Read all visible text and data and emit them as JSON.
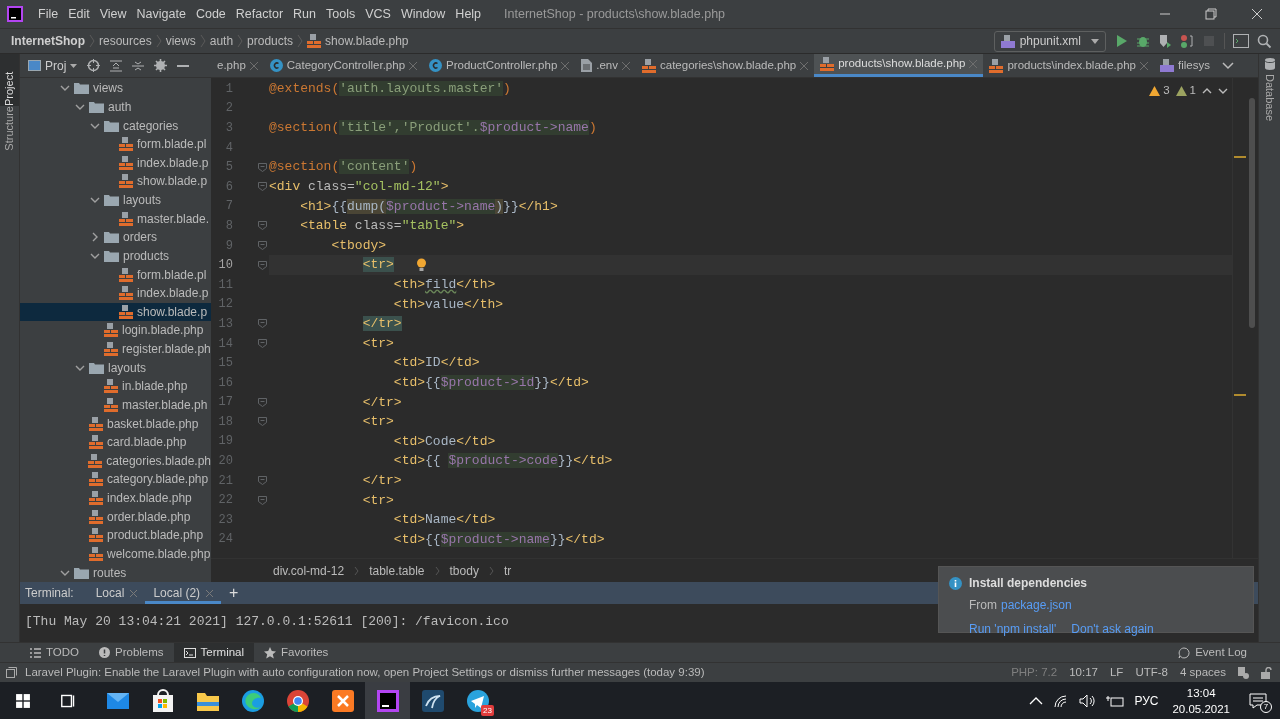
{
  "window": {
    "title": "InternetShop - products\\show.blade.php"
  },
  "menu": [
    "File",
    "Edit",
    "View",
    "Navigate",
    "Code",
    "Refactor",
    "Run",
    "Tools",
    "VCS",
    "Window",
    "Help"
  ],
  "navbar": {
    "crumbs": [
      "InternetShop",
      "resources",
      "views",
      "auth",
      "products",
      "show.blade.php"
    ],
    "run_config": "phpunit.xml"
  },
  "side_tabs": [
    {
      "label": "Project",
      "selected": true
    },
    {
      "label": "Structure",
      "selected": false
    }
  ],
  "right_tabs": [
    {
      "label": "Database",
      "selected": false
    }
  ],
  "project_panel": {
    "title": "Proj"
  },
  "editor_tabs": [
    {
      "label": "e.php",
      "selected": false
    },
    {
      "label": "CategoryController.php",
      "kind": "class",
      "selected": false
    },
    {
      "label": "ProductController.php",
      "kind": "class",
      "selected": false
    },
    {
      "label": ".env",
      "kind": "text",
      "selected": false
    },
    {
      "label": "categories\\show.blade.php",
      "kind": "blade",
      "selected": false
    },
    {
      "label": "products\\show.blade.php",
      "kind": "blade",
      "selected": true
    },
    {
      "label": "products\\index.blade.php",
      "kind": "blade",
      "selected": false
    },
    {
      "label": "filesys",
      "kind": "php",
      "selected": false
    }
  ],
  "tree": [
    {
      "name": "views",
      "kind": "folder",
      "expanded": true,
      "selected": false,
      "children": [
        {
          "name": "auth",
          "kind": "folder",
          "expanded": true,
          "selected": false,
          "children": [
            {
              "name": "categories",
              "kind": "folder",
              "expanded": true,
              "selected": false,
              "children": [
                {
                  "name": "form.blade.pl",
                  "kind": "file",
                  "selected": false
                },
                {
                  "name": "index.blade.p",
                  "kind": "file",
                  "selected": false
                },
                {
                  "name": "show.blade.p",
                  "kind": "file",
                  "selected": false
                }
              ]
            },
            {
              "name": "layouts",
              "kind": "folder",
              "expanded": true,
              "selected": false,
              "children": [
                {
                  "name": "master.blade.",
                  "kind": "file",
                  "selected": false
                }
              ]
            },
            {
              "name": "orders",
              "kind": "folder",
              "expanded": false,
              "selected": false
            },
            {
              "name": "products",
              "kind": "folder",
              "expanded": true,
              "selected": false,
              "children": [
                {
                  "name": "form.blade.pl",
                  "kind": "file",
                  "selected": false
                },
                {
                  "name": "index.blade.p",
                  "kind": "file",
                  "selected": false
                },
                {
                  "name": "show.blade.p",
                  "kind": "file",
                  "selected": true
                }
              ]
            },
            {
              "name": "login.blade.php",
              "kind": "file",
              "selected": false
            },
            {
              "name": "register.blade.ph",
              "kind": "file",
              "selected": false
            }
          ]
        },
        {
          "name": "layouts",
          "kind": "folder",
          "expanded": true,
          "selected": false,
          "children": [
            {
              "name": "in.blade.php",
              "kind": "file",
              "selected": false
            },
            {
              "name": "master.blade.ph",
              "kind": "file",
              "selected": false
            }
          ]
        },
        {
          "name": "basket.blade.php",
          "kind": "file",
          "selected": false
        },
        {
          "name": "card.blade.php",
          "kind": "file",
          "selected": false
        },
        {
          "name": "categories.blade.ph",
          "kind": "file",
          "selected": false
        },
        {
          "name": "category.blade.php",
          "kind": "file",
          "selected": false
        },
        {
          "name": "index.blade.php",
          "kind": "file",
          "selected": false
        },
        {
          "name": "order.blade.php",
          "kind": "file",
          "selected": false
        },
        {
          "name": "product.blade.php",
          "kind": "file",
          "selected": false
        },
        {
          "name": "welcome.blade.php",
          "kind": "file",
          "selected": false
        }
      ]
    },
    {
      "name": "routes",
      "kind": "folder",
      "expanded": true,
      "selected": false
    }
  ],
  "inspections": {
    "warnings": "3",
    "weak_warnings": "1"
  },
  "code": [
    {
      "number": "1",
      "current": false,
      "fold": false,
      "tokens": [
        {
          "kind": "directive",
          "text": "@extends("
        },
        {
          "kind": "string",
          "text": "'auth.layouts.master'"
        },
        {
          "kind": "directive",
          "text": ")"
        }
      ]
    },
    {
      "number": "2",
      "current": false,
      "fold": false
    },
    {
      "number": "3",
      "current": false,
      "fold": false,
      "tokens": [
        {
          "kind": "directive",
          "text": "@section("
        },
        {
          "kind": "string",
          "text": "'title','Product'."
        },
        {
          "kind": "variable",
          "text": "$product->name"
        },
        {
          "kind": "directive",
          "text": ")"
        }
      ]
    },
    {
      "number": "4",
      "current": false,
      "fold": false
    },
    {
      "number": "5",
      "current": false,
      "fold": true,
      "tokens": [
        {
          "kind": "directive",
          "text": "@section("
        },
        {
          "kind": "string",
          "text": "'content'"
        },
        {
          "kind": "directive",
          "text": ")"
        }
      ]
    },
    {
      "number": "6",
      "current": false,
      "fold": true,
      "tokens": [
        {
          "kind": "tag",
          "text": "<div "
        },
        {
          "kind": "attr",
          "text": "class="
        },
        {
          "kind": "value",
          "text": "\"col-md-12\""
        },
        {
          "kind": "tag",
          "text": ">"
        }
      ]
    },
    {
      "number": "7",
      "current": false,
      "fold": false,
      "tokens": [
        {
          "kind": "tag",
          "text": "    <h1>"
        },
        {
          "kind": "text",
          "text": "{{"
        },
        {
          "kind": "call",
          "text": "dump("
        },
        {
          "kind": "variable",
          "text": "$product->name"
        },
        {
          "kind": "call",
          "text": ")"
        },
        {
          "kind": "text",
          "text": "}}"
        },
        {
          "kind": "tag",
          "text": "</h1>"
        }
      ]
    },
    {
      "number": "8",
      "current": false,
      "fold": true,
      "tokens": [
        {
          "kind": "tag",
          "text": "    <table "
        },
        {
          "kind": "attr",
          "text": "class="
        },
        {
          "kind": "value",
          "text": "\"table\""
        },
        {
          "kind": "tag",
          "text": ">"
        }
      ]
    },
    {
      "number": "9",
      "current": false,
      "fold": true,
      "tokens": [
        {
          "kind": "tag",
          "text": "        <tbody>"
        }
      ]
    },
    {
      "number": "10",
      "current": true,
      "fold": true,
      "tokens": [
        {
          "kind": "match",
          "text": "            <tr>"
        }
      ]
    },
    {
      "number": "11",
      "current": false,
      "fold": false,
      "tokens": [
        {
          "kind": "tag",
          "text": "                <th>"
        },
        {
          "kind": "typo",
          "text": "fild"
        },
        {
          "kind": "tag",
          "text": "</th>"
        }
      ]
    },
    {
      "number": "12",
      "current": false,
      "fold": false,
      "tokens": [
        {
          "kind": "tag",
          "text": "                <th>"
        },
        {
          "kind": "text",
          "text": "value"
        },
        {
          "kind": "tag",
          "text": "</th>"
        }
      ]
    },
    {
      "number": "13",
      "current": false,
      "fold": true,
      "tokens": [
        {
          "kind": "match",
          "text": "            </tr>"
        }
      ]
    },
    {
      "number": "14",
      "current": false,
      "fold": true,
      "tokens": [
        {
          "kind": "tag",
          "text": "            <tr>"
        }
      ]
    },
    {
      "number": "15",
      "current": false,
      "fold": false,
      "tokens": [
        {
          "kind": "tag",
          "text": "                <td>"
        },
        {
          "kind": "text",
          "text": "ID"
        },
        {
          "kind": "tag",
          "text": "</td>"
        }
      ]
    },
    {
      "number": "16",
      "current": false,
      "fold": false,
      "tokens": [
        {
          "kind": "tag",
          "text": "                <td>"
        },
        {
          "kind": "text",
          "text": "{{"
        },
        {
          "kind": "variable",
          "text": "$product->id"
        },
        {
          "kind": "text",
          "text": "}}"
        },
        {
          "kind": "tag",
          "text": "</td>"
        }
      ]
    },
    {
      "number": "17",
      "current": false,
      "fold": true,
      "tokens": [
        {
          "kind": "tag",
          "text": "            </tr>"
        }
      ]
    },
    {
      "number": "18",
      "current": false,
      "fold": true,
      "tokens": [
        {
          "kind": "tag",
          "text": "            <tr>"
        }
      ]
    },
    {
      "number": "19",
      "current": false,
      "fold": false,
      "tokens": [
        {
          "kind": "tag",
          "text": "                <td>"
        },
        {
          "kind": "text",
          "text": "Code"
        },
        {
          "kind": "tag",
          "text": "</td>"
        }
      ]
    },
    {
      "number": "20",
      "current": false,
      "fold": false,
      "tokens": [
        {
          "kind": "tag",
          "text": "                <td>"
        },
        {
          "kind": "text",
          "text": "{{"
        },
        {
          "kind": "variable",
          "text": " $product->code"
        },
        {
          "kind": "text",
          "text": "}}"
        },
        {
          "kind": "tag",
          "text": "</td>"
        }
      ]
    },
    {
      "number": "21",
      "current": false,
      "fold": true,
      "tokens": [
        {
          "kind": "tag",
          "text": "            </tr>"
        }
      ]
    },
    {
      "number": "22",
      "current": false,
      "fold": true,
      "tokens": [
        {
          "kind": "tag",
          "text": "            <tr>"
        }
      ]
    },
    {
      "number": "23",
      "current": false,
      "fold": false,
      "tokens": [
        {
          "kind": "tag",
          "text": "                <td>"
        },
        {
          "kind": "text",
          "text": "Name"
        },
        {
          "kind": "tag",
          "text": "</td>"
        }
      ]
    },
    {
      "number": "24",
      "current": false,
      "fold": false,
      "tokens": [
        {
          "kind": "tag",
          "text": "                <td>"
        },
        {
          "kind": "text",
          "text": "{{"
        },
        {
          "kind": "variable",
          "text": "$product->name"
        },
        {
          "kind": "text",
          "text": "}}"
        },
        {
          "kind": "tag",
          "text": "</td>"
        }
      ]
    }
  ],
  "editor_breadcrumbs": [
    "div.col-md-12",
    "table.table",
    "tbody",
    "tr"
  ],
  "terminal": {
    "label": "Terminal:",
    "tabs": [
      {
        "label": "Local",
        "selected": false
      },
      {
        "label": "Local (2)",
        "selected": true
      }
    ],
    "add": "+",
    "output": "[Thu May 20 13:04:21 2021] 127.0.0.1:52611 [200]: /favicon.ico"
  },
  "notification": {
    "title": "Install dependencies",
    "text": "From",
    "link": "package.json",
    "actions": [
      "Run 'npm install'",
      "Don't ask again"
    ]
  },
  "tool_windows": [
    {
      "label": "TODO",
      "kind": "list",
      "selected": false
    },
    {
      "label": "Problems",
      "kind": "problems",
      "selected": false
    },
    {
      "label": "Terminal",
      "kind": "terminal",
      "selected": true
    },
    {
      "label": "Favorites",
      "kind": "star",
      "selected": false
    }
  ],
  "event_log": "Event Log",
  "status_bar": {
    "message": "Laravel Plugin: Enable the Laravel Plugin with auto configuration now, open Project Settings or dismiss further messages (today 9:39)",
    "items": [
      "PHP: 7.2",
      "10:17",
      "LF",
      "UTF-8",
      "4 spaces"
    ]
  },
  "taskbar": {
    "apps": [
      {
        "kind": "start",
        "selected": false
      },
      {
        "kind": "taskview",
        "selected": false
      },
      {
        "kind": "mail",
        "selected": false
      },
      {
        "kind": "store",
        "selected": false
      },
      {
        "kind": "explorer",
        "selected": false
      },
      {
        "kind": "edge",
        "selected": false
      },
      {
        "kind": "chrome",
        "selected": false
      },
      {
        "kind": "xampp",
        "selected": false
      },
      {
        "kind": "ide",
        "selected": true
      },
      {
        "kind": "database",
        "selected": false
      },
      {
        "kind": "telegram",
        "selected": false,
        "badge": "23"
      }
    ],
    "language": "РУС",
    "time": "13:04",
    "date": "20.05.2021",
    "notifications": "7"
  }
}
